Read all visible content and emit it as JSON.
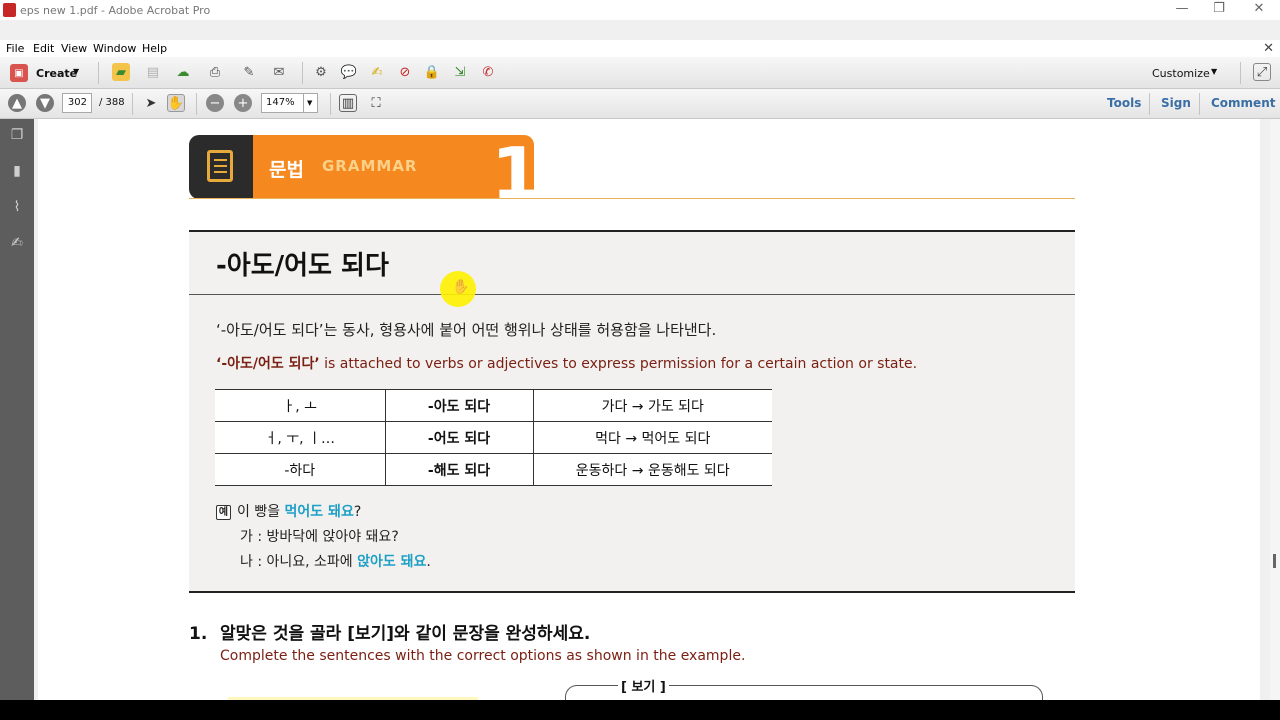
{
  "window": {
    "title": "eps new 1.pdf - Adobe Acrobat Pro",
    "controls": [
      "—",
      "❐",
      "✕"
    ]
  },
  "menu": [
    "File",
    "Edit",
    "View",
    "Window",
    "Help"
  ],
  "toolbar1": {
    "create_label": "Create",
    "customize_label": "Customize",
    "icons": [
      "open-folder-icon",
      "save-icon",
      "upload-icon",
      "print-icon",
      "edit-icon",
      "email-icon",
      "gear-icon",
      "comment-icon",
      "sticky-note-icon",
      "delete-icon",
      "lock-icon",
      "export-icon",
      "stamp-icon"
    ]
  },
  "toolbar2": {
    "page_current": "302",
    "page_total": "/ 388",
    "zoom": "147%",
    "links": [
      "Tools",
      "Sign",
      "Comment"
    ]
  },
  "document": {
    "header_ko": "문법",
    "header_en": "GRAMMAR",
    "header_num": "1",
    "grammar_title": "-아도/어도 되다",
    "desc_ko": "‘-아도/어도 되다’는 동사, 형용사에 붙어 어떤 행위나 상태를 허용함을 나타낸다.",
    "desc_en_bold": "‘-아도/어도 되다’",
    "desc_en_rest": " is attached to verbs or adjectives to express permission for a certain action or state.",
    "table": [
      [
        "ㅏ, ㅗ",
        "-아도 되다",
        "가다 → 가도 되다"
      ],
      [
        "ㅓ, ㅜ, ㅣ…",
        "-어도 되다",
        "먹다 → 먹어도 되다"
      ],
      [
        "-하다",
        "-해도 되다",
        "운동하다 → 운동해도 되다"
      ]
    ],
    "example": {
      "tag": "예",
      "line1_pre": "이 빵을 ",
      "line1_hl": "먹어도 돼요",
      "line1_post": "?",
      "line2": "가 : 방바닥에 앉아야 돼요?",
      "line3_pre": "나 : 아니요, 소파에 ",
      "line3_hl": "앉아도 돼요",
      "line3_post": "."
    },
    "question_num": "1.",
    "question_ko": "알맞은 것을 골라 [보기]와 같이 문장을 완성하세요.",
    "question_en": "Complete the sentences with the correct options as shown in the example.",
    "bogi_label": "[ 보기 ]"
  }
}
